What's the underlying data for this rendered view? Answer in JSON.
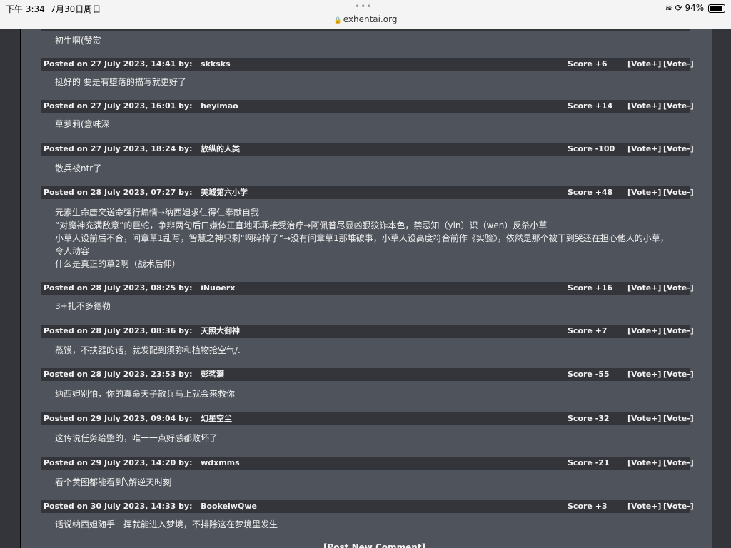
{
  "status_bar": {
    "time": "下午 3:34",
    "date": "7月30日周日",
    "url": "exhentai.org",
    "battery": "94%"
  },
  "first_comment_tail": "初生啊(赞赏",
  "comments": [
    {
      "posted": "Posted on 27 July 2023, 14:41 by:",
      "user": "skksks",
      "score": "Score +6",
      "text": "挺好的 要是有堕落的描写就更好了"
    },
    {
      "posted": "Posted on 27 July 2023, 16:01 by:",
      "user": "heyimao",
      "score": "Score +14",
      "text": "草萝莉(意味深"
    },
    {
      "posted": "Posted on 27 July 2023, 18:24 by:",
      "user": "放纵的人类",
      "score": "Score -100",
      "text": "散兵被ntr了"
    },
    {
      "posted": "Posted on 28 July 2023, 07:27 by:",
      "user": "美城第六小学",
      "score": "Score +48",
      "text": "元素生命唐突送命强行煽情→纳西妲求仁得仁奉献自我\n“对魔神充满敌意”的巨蛇，争辩两句后口嫌体正直地乖乖接受治疗→阿佩普尽显凶狠狡诈本色，禁忌知（yin）识（wen）反杀小草\n小草人设前后不合，间章草1乱写，智慧之神只剩“啊碎掉了”→没有间章草1那堆破事，小草人设高度符合前作《实验》，依然是那个被干到哭还在担心他人的小草，\n令人动容\n什么是真正的草2啊（战术后仰）"
    },
    {
      "posted": "Posted on 28 July 2023, 08:25 by:",
      "user": "iNuoerx",
      "score": "Score +16",
      "text": "3+扎不多德勒"
    },
    {
      "posted": "Posted on 28 July 2023, 08:36 by:",
      "user": "天照大御神",
      "score": "Score +7",
      "text": "蒸馍，不扶器的话，就发配到须弥和植物抢空气/."
    },
    {
      "posted": "Posted on 28 July 2023, 23:53 by:",
      "user": "彭茗灏",
      "score": "Score -55",
      "text": "纳西妲别怕，你的真命天子散兵马上就会来救你"
    },
    {
      "posted": "Posted on 29 July 2023, 09:04 by:",
      "user": "幻星空尘",
      "score": "Score -32",
      "text": "这传说任务给整的，唯一一点好感都败坏了"
    },
    {
      "posted": "Posted on 29 July 2023, 14:20 by:",
      "user": "wdxmms",
      "score": "Score -21",
      "text": "看个黄图都能看到╲解逆天时刻"
    },
    {
      "posted": "Posted on 30 July 2023, 14:33 by:",
      "user": "BookelwQwe",
      "score": "Score +3",
      "text": "话说纳西妲随手一挥就能进入梦境，不排除这在梦境里发生"
    }
  ],
  "vote_plus": "[Vote+]",
  "vote_minus": "[Vote-]",
  "post_new_comment": "[Post New Comment]"
}
